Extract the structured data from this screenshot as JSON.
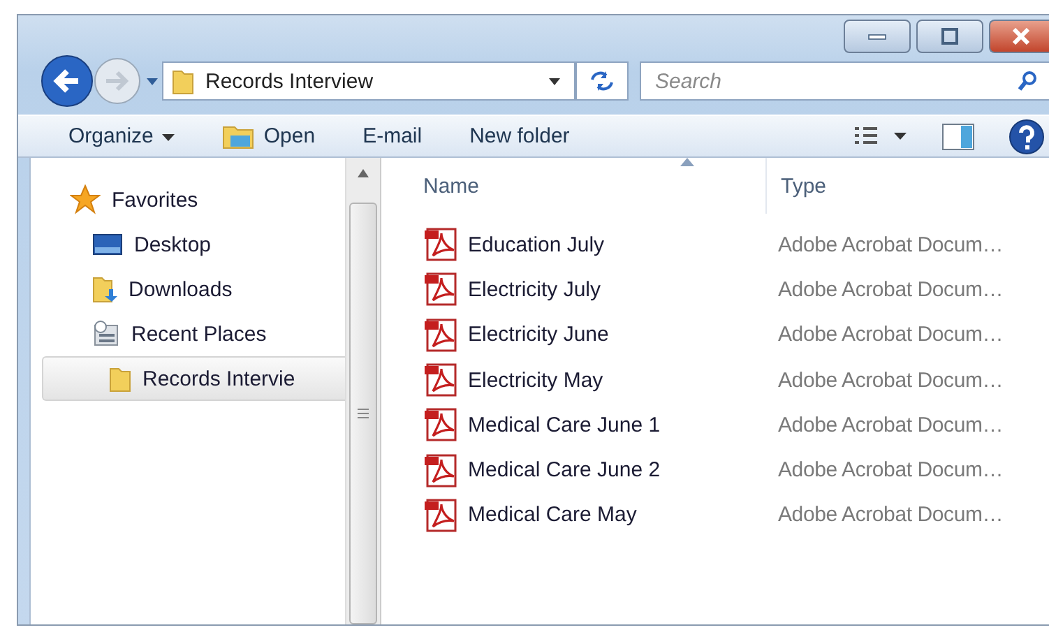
{
  "address_bar": {
    "location": "Records Interview"
  },
  "search": {
    "placeholder": "Search"
  },
  "toolbar": {
    "items": [
      {
        "label": "Organize",
        "kind": "menu"
      },
      {
        "label": "Open",
        "kind": "open"
      },
      {
        "label": "E-mail",
        "kind": "plain"
      },
      {
        "label": "New folder",
        "kind": "plain"
      }
    ]
  },
  "sidebar": {
    "header": "Favorites",
    "items": [
      {
        "label": "Desktop",
        "kind": "desktop",
        "selected": false
      },
      {
        "label": "Downloads",
        "kind": "downloads",
        "selected": false
      },
      {
        "label": "Recent Places",
        "kind": "recent",
        "selected": false
      },
      {
        "label": "Records Intervie",
        "kind": "folder",
        "selected": true
      }
    ]
  },
  "table": {
    "columns": [
      {
        "label": "Name",
        "sorted": true
      },
      {
        "label": "Type",
        "sorted": false
      }
    ],
    "rows": [
      {
        "name": "Education July",
        "type": "Adobe Acrobat Docum…"
      },
      {
        "name": "Electricity July",
        "type": "Adobe Acrobat Docum…"
      },
      {
        "name": "Electricity June",
        "type": "Adobe Acrobat Docum…"
      },
      {
        "name": "Electricity May",
        "type": "Adobe Acrobat Docum…"
      },
      {
        "name": "Medical Care June 1",
        "type": "Adobe Acrobat Docum…"
      },
      {
        "name": "Medical Care June 2",
        "type": "Adobe Acrobat Docum…"
      },
      {
        "name": "Medical Care May",
        "type": "Adobe Acrobat Docum…"
      }
    ]
  }
}
